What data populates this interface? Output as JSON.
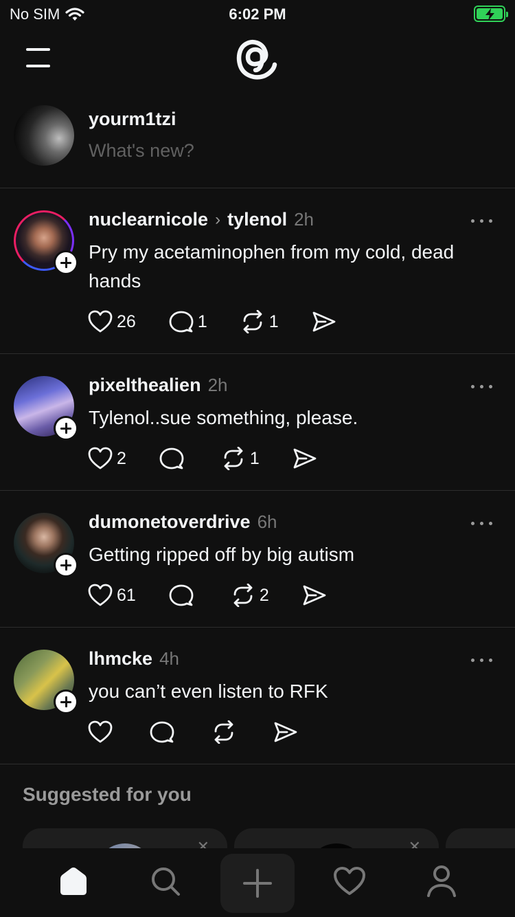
{
  "status_bar": {
    "carrier": "No SIM",
    "time": "6:02 PM",
    "wifi_icon": "wifi-icon",
    "battery_icon": "battery-charging-icon",
    "battery_color": "#30d158"
  },
  "header": {
    "menu_icon": "hamburger-menu-icon",
    "logo_icon": "threads-logo-icon"
  },
  "composer": {
    "username": "yourm1tzi",
    "placeholder": "What's new?"
  },
  "posts": [
    {
      "username": "nuclearnicole",
      "reply_to": "tylenol",
      "time": "2h",
      "text": "Pry my acetaminophen from my cold, dead hands",
      "likes": "26",
      "comments": "1",
      "reposts": "1"
    },
    {
      "username": "pixelthealien",
      "time": "2h",
      "text": "Tylenol..sue something, please.",
      "likes": "2",
      "comments": "",
      "reposts": "1"
    },
    {
      "username": "dumonetoverdrive",
      "time": "6h",
      "text": "Getting ripped off by big autism",
      "likes": "61",
      "comments": "",
      "reposts": "2"
    },
    {
      "username": "lhmcke",
      "time": "4h",
      "text": "you can’t even listen to RFK",
      "likes": "",
      "comments": "",
      "reposts": ""
    }
  ],
  "suggested": {
    "title": "Suggested for you"
  },
  "bottom_nav": {
    "items": [
      "home-icon",
      "search-icon",
      "create-plus-icon",
      "activity-heart-icon",
      "profile-icon"
    ],
    "active": "home-icon"
  },
  "colors": {
    "background": "#101010",
    "text": "#f3f5f7",
    "muted": "#777777",
    "divider": "#2d2d2d"
  }
}
